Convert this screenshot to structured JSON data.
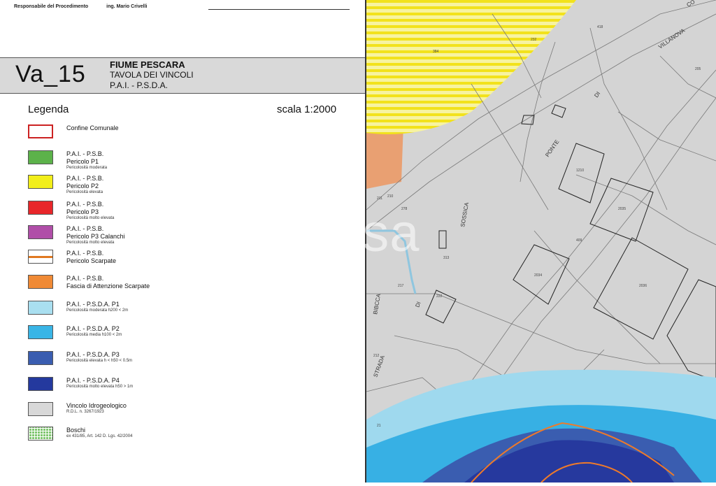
{
  "header": {
    "responsible_label": "Responsabile del Procedimento",
    "responsible_name": "ing. Mario Crivelli"
  },
  "title": {
    "code": "Va_15",
    "line1": "FIUME PESCARA",
    "line2": "TAVOLA DEI VINCOLI",
    "line3": "P.A.I. - P.S.D.A."
  },
  "legend": {
    "heading": "Legenda",
    "scale": "scala 1:2000",
    "items": [
      {
        "l1": "Confine Comunale",
        "l2": "",
        "n": "",
        "color": "#ffffff",
        "border": "#cc2222"
      },
      {
        "l1": "P.A.I. - P.S.B.",
        "l2": "Pericolo P1",
        "n": "Pericolosità moderata",
        "color": "#5cb24a"
      },
      {
        "l1": "P.A.I. - P.S.B.",
        "l2": "Pericolo P2",
        "n": "Pericolosità elevata",
        "color": "#f2ee1a"
      },
      {
        "l1": "P.A.I. - P.S.B.",
        "l2": "Pericolo P3",
        "n": "Pericolosità molto elevata",
        "color": "#e8262a"
      },
      {
        "l1": "P.A.I. - P.S.B.",
        "l2": "Pericolo P3 Calanchi",
        "n": "Pericolosità molto elevata",
        "color": "#b04ea8"
      },
      {
        "l1": "P.A.I. - P.S.B.",
        "l2": "Pericolo Scarpate",
        "n": "",
        "color": "#ffffff",
        "line": "#e07820"
      },
      {
        "l1": "P.A.I. - P.S.B.",
        "l2": "Fascia di Attenzione Scarpate",
        "n": "",
        "color": "#f08a35"
      },
      {
        "l1": "P.A.I. - P.S.D.A. P1",
        "l2": "",
        "n": "Pericolosità moderata h200 < 2m",
        "color": "#a9dff0"
      },
      {
        "l1": "P.A.I. - P.S.D.A. P2",
        "l2": "",
        "n": "Pericolosità media h100 < 2m",
        "color": "#39b5e6"
      },
      {
        "l1": "P.A.I. - P.S.D.A.  P3",
        "l2": "",
        "n": "Pericolosità elevata  h < h50 < 0.5m",
        "color": "#3a5db0"
      },
      {
        "l1": "P.A.I. - P.S.D.A.  P4",
        "l2": "",
        "n": "Pericolosità molto elevata  h50 > 1m",
        "color": "#24399e"
      },
      {
        "l1": "Vincolo Idrogeologico",
        "l2": "",
        "n": "R.D.L. n. 3267/1923",
        "color": "#d8d8d8"
      },
      {
        "l1": "Boschi",
        "l2": "",
        "n": "ex 431/85, Art. 142 D. Lgs. 42/2004",
        "color": "#7fc66f",
        "hatch": true
      }
    ]
  },
  "map": {
    "road_labels": [
      "VILLANOVA",
      "PONTE",
      "DI",
      "STRADA",
      "DI",
      "SOSSICA",
      "BIBCCA",
      "CO"
    ],
    "parcel_numbers": [
      "384",
      "418",
      "232",
      "205",
      "1210",
      "2035",
      "2036",
      "2034",
      "278",
      "313",
      "217",
      "211",
      "210",
      "222",
      "212",
      "409",
      "21"
    ]
  },
  "watermark": "trovacasa"
}
